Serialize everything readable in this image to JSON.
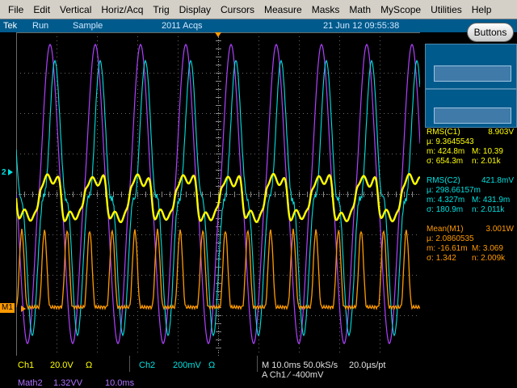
{
  "menu": [
    "File",
    "Edit",
    "Vertical",
    "Horiz/Acq",
    "Trig",
    "Display",
    "Cursors",
    "Measure",
    "Masks",
    "Math",
    "MyScope",
    "Utilities",
    "Help"
  ],
  "status": {
    "brand": "Tek",
    "run": "Run",
    "mode": "Sample",
    "acqs": "2011 Acqs",
    "datetime": "21 Jun 12 09:55:38"
  },
  "buttons_label": "Buttons",
  "markers": {
    "ch2": "2",
    "m1": "M1"
  },
  "measurements": [
    {
      "title": "RMS(C1)",
      "value": "8.903V",
      "color": "#ffff00",
      "rows": [
        [
          "µ: 9.3645543",
          ""
        ],
        [
          "m: 424.8m",
          "M: 10.39"
        ],
        [
          "σ: 654.3m",
          "n: 2.01k"
        ]
      ]
    },
    {
      "title": "RMS(C2)",
      "value": "421.8mV",
      "color": "#00e0e0",
      "rows": [
        [
          "µ: 298.66157m",
          ""
        ],
        [
          "m: 4.327m",
          "M: 431.9m"
        ],
        [
          "σ: 180.9m",
          "n: 2.011k"
        ]
      ]
    },
    {
      "title": "Mean(M1)",
      "value": "3.001W",
      "color": "#ff9a00",
      "rows": [
        [
          "µ: 2.0860535",
          ""
        ],
        [
          "m: -16.61m",
          "M: 3.069"
        ],
        [
          "σ: 1.342",
          "n: 2.009k"
        ]
      ]
    }
  ],
  "readout": {
    "ch1_label": "Ch1",
    "ch1_scale": "20.0V",
    "ch1_bw": "Ω",
    "ch2_label": "Ch2",
    "ch2_scale": "200mV",
    "ch2_bw": "Ω",
    "timebase": "M 10.0ms 50.0kS/s",
    "resolution": "20.0µs/pt",
    "trigger": "A  Ch1  ⁄  -400mV",
    "math2_label": "Math2",
    "math2_scale": "1.32VV",
    "math2_time": "10.0ms"
  },
  "colors": {
    "ch1": "#ffff00",
    "ch2": "#00e0e0",
    "math1": "#ff9a00",
    "math2": "#b040ff",
    "panel": "#005a8c",
    "menu": "#d4d0c8"
  }
}
